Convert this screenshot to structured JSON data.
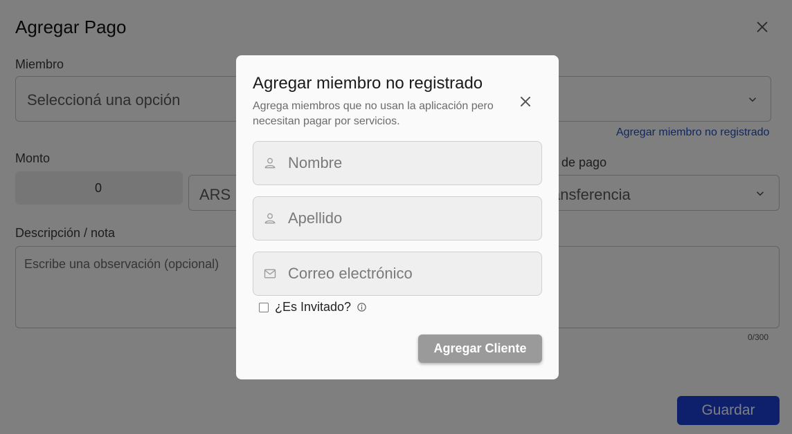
{
  "background": {
    "title": "Agregar Pago",
    "member": {
      "label": "Miembro",
      "placeholder": "Seleccioná una opción",
      "add_link": "Agregar miembro no registrado"
    },
    "amount": {
      "label": "Monto",
      "value": "0",
      "currency": "ARS"
    },
    "payment_method": {
      "label_partial": "o de pago",
      "value_partial": "ansferencia"
    },
    "description": {
      "label": "Descripción / nota",
      "placeholder": "Escribe una observación (opcional)",
      "counter": "0/300"
    },
    "save_label": "Guardar"
  },
  "modal": {
    "title": "Agregar miembro no registrado",
    "subtitle": "Agrega miembros que no usan la aplicación pero necesitan pagar por servicios.",
    "fields": {
      "first_name_placeholder": "Nombre",
      "last_name_placeholder": "Apellido",
      "email_placeholder": "Correo electrónico"
    },
    "guest_checkbox": {
      "label": "¿Es Invitado?",
      "checked": false
    },
    "submit_label": "Agregar Cliente"
  },
  "icons": {
    "close": "close-icon",
    "chevron": "chevron-down-icon",
    "user": "user-icon",
    "mail": "mail-icon",
    "info": "info-icon"
  },
  "colors": {
    "primary": "#1c3fd6",
    "link": "#1e4fc2",
    "disabled_button": "#9a9a9a",
    "overlay": "rgba(0,0,0,0.5)"
  }
}
